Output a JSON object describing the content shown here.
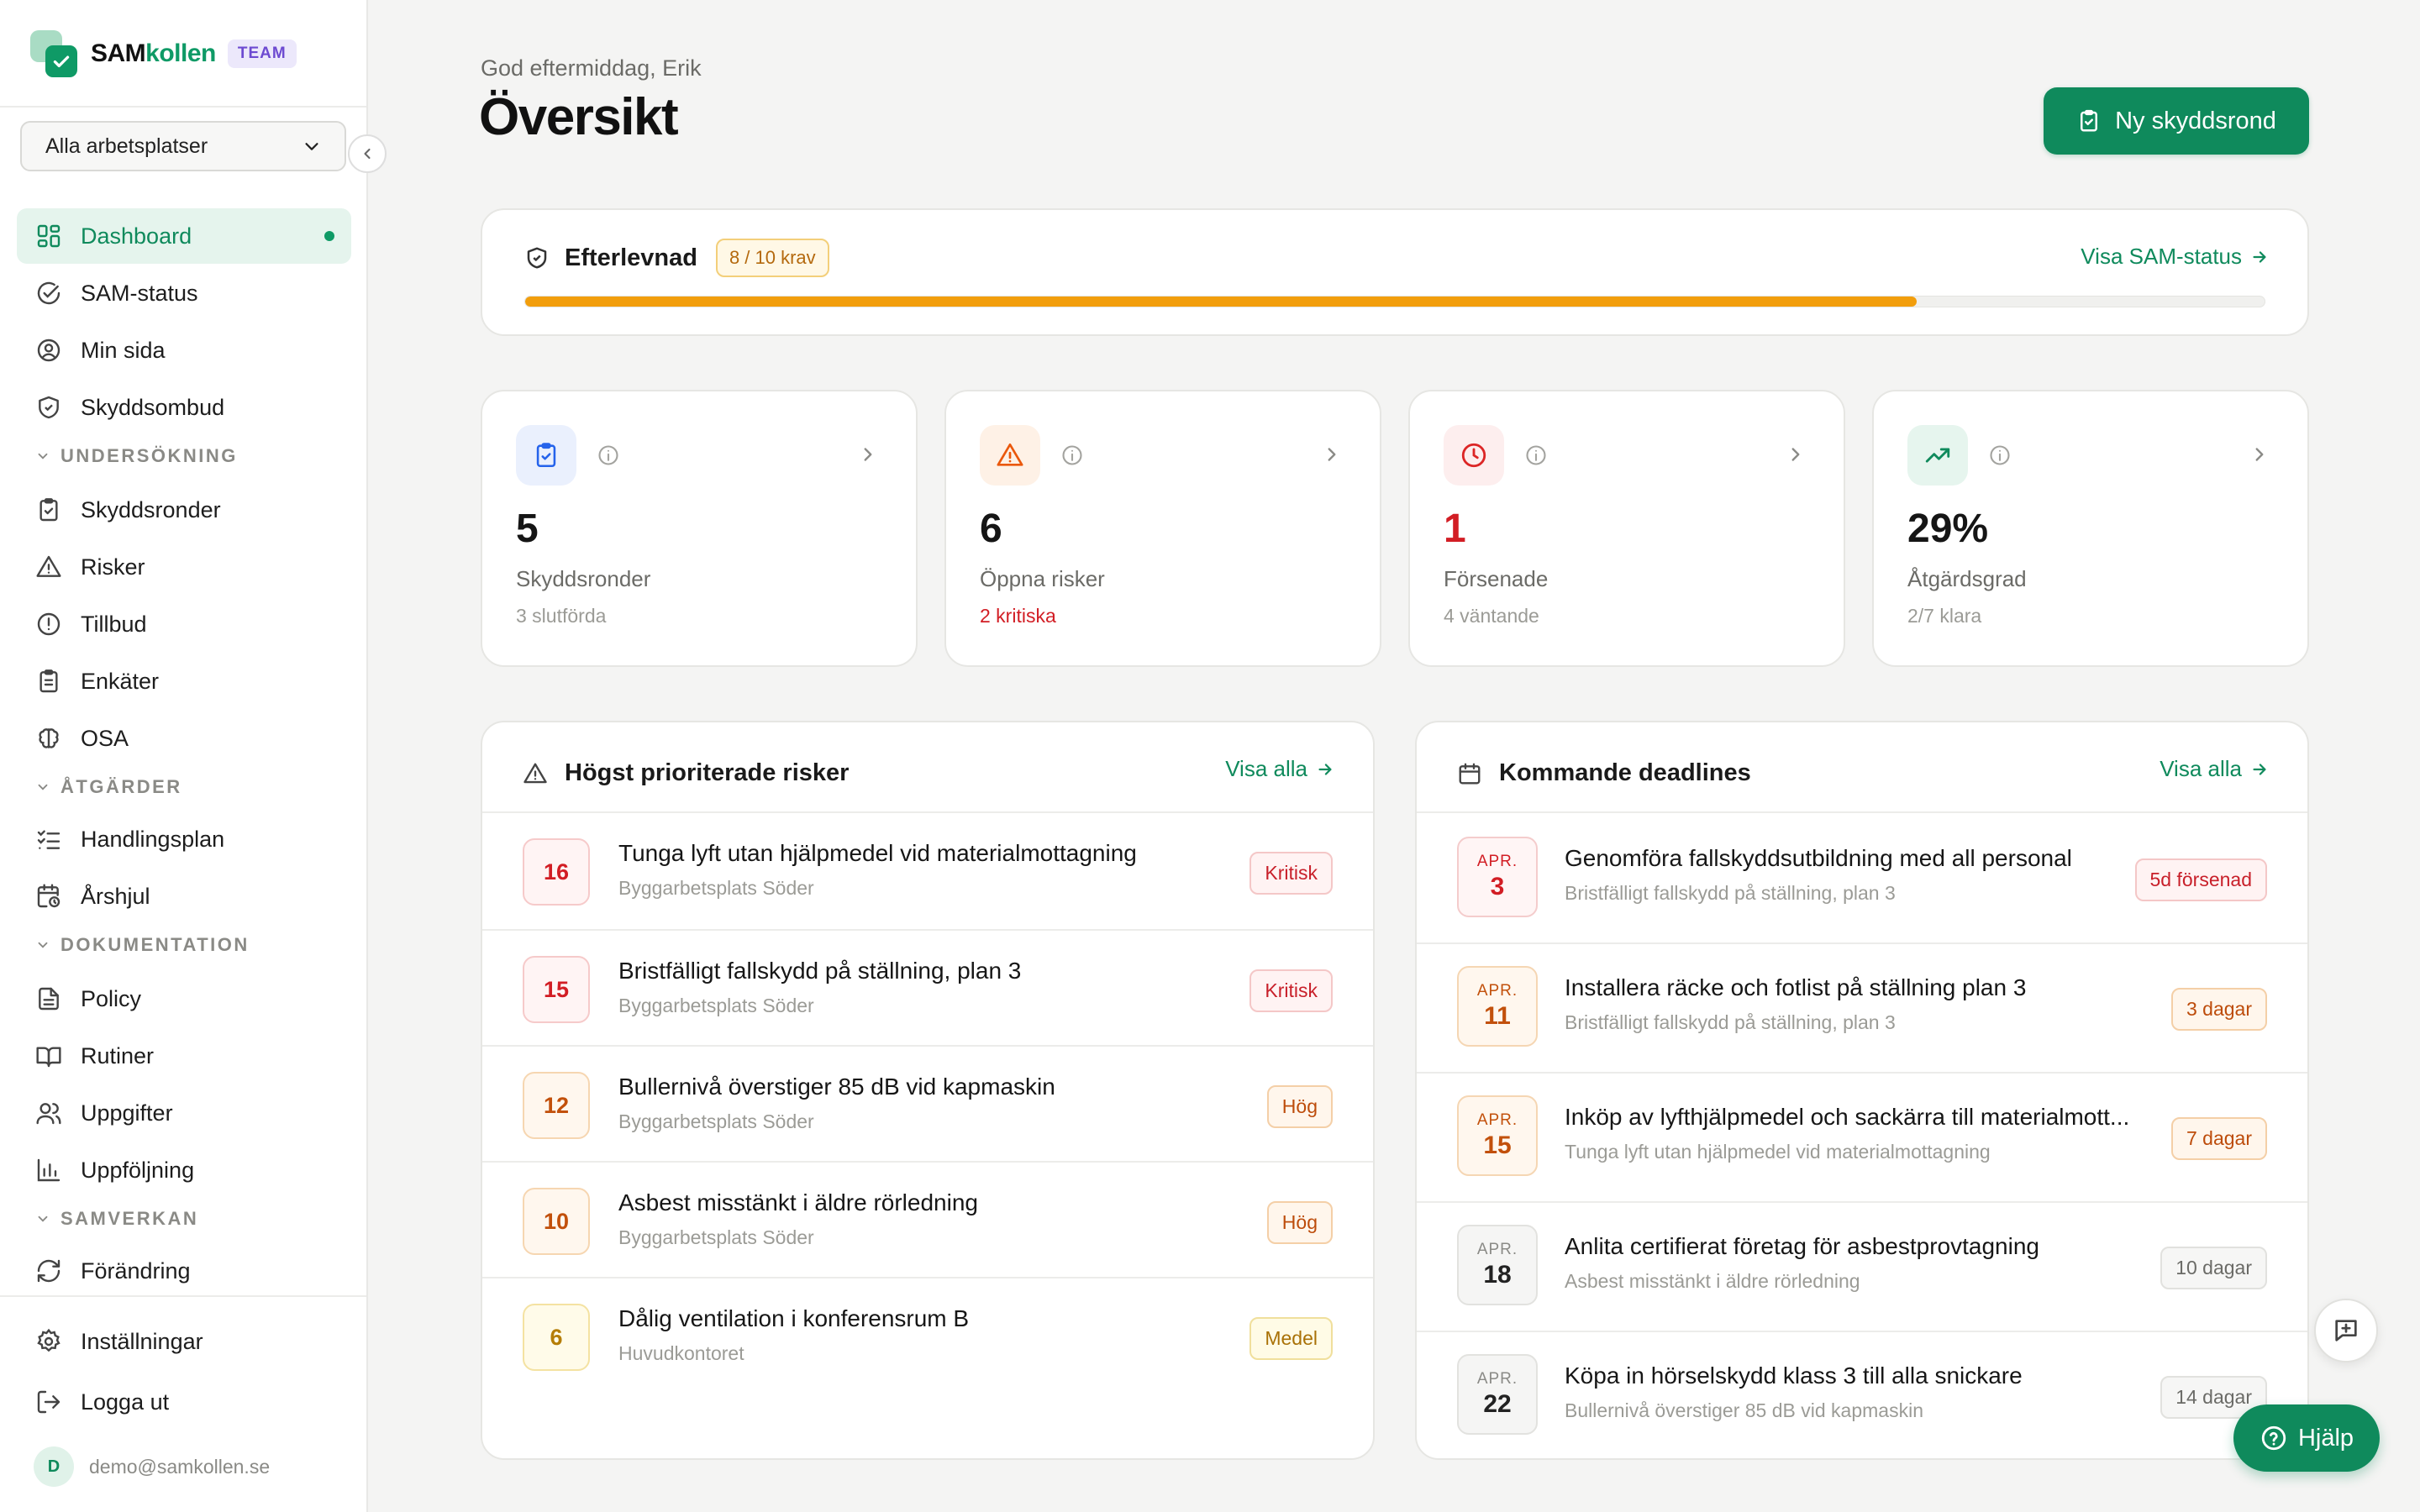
{
  "brand": {
    "name_part1": "SAM",
    "name_part2": "kollen",
    "badge": "TEAM"
  },
  "workspace_select": {
    "value": "Alla arbetsplatser"
  },
  "nav": {
    "dashboard": "Dashboard",
    "sam_status": "SAM-status",
    "min_sida": "Min sida",
    "skyddsombud": "Skyddsombud",
    "section_undersokning": "UNDERSÖKNING",
    "skyddsronder": "Skyddsronder",
    "risker": "Risker",
    "tillbud": "Tillbud",
    "enkater": "Enkäter",
    "osa": "OSA",
    "section_atgarder": "ÅTGÄRDER",
    "handlingsplan": "Handlingsplan",
    "arshjul": "Årshjul",
    "section_dokumentation": "DOKUMENTATION",
    "policy": "Policy",
    "rutiner": "Rutiner",
    "uppgifter": "Uppgifter",
    "uppfoljning": "Uppföljning",
    "section_samverkan": "SAMVERKAN",
    "forandring": "Förändring",
    "installningar": "Inställningar",
    "logga_ut": "Logga ut"
  },
  "user": {
    "initial": "D",
    "email": "demo@samkollen.se"
  },
  "header": {
    "greeting": "God eftermiddag, Erik",
    "title": "Översikt",
    "primary_button": "Ny skyddsrond"
  },
  "compliance": {
    "title": "Efterlevnad",
    "badge": "8 / 10 krav",
    "link": "Visa SAM-status",
    "progress": 0.8
  },
  "stats": [
    {
      "value": "5",
      "label": "Skyddsronder",
      "sub": "3 slutförda"
    },
    {
      "value": "6",
      "label": "Öppna risker",
      "sub": "2 kritiska"
    },
    {
      "value": "1",
      "label": "Försenade",
      "sub": "4 väntande"
    },
    {
      "value": "29%",
      "label": "Åtgärdsgrad",
      "sub": "2/7 klara"
    }
  ],
  "risks": {
    "title": "Högst prioriterade risker",
    "link": "Visa alla",
    "items": [
      {
        "score": "16",
        "title": "Tunga lyft utan hjälpmedel vid materialmottagning",
        "location": "Byggarbetsplats Söder",
        "level": "Kritisk"
      },
      {
        "score": "15",
        "title": "Bristfälligt fallskydd på ställning, plan 3",
        "location": "Byggarbetsplats Söder",
        "level": "Kritisk"
      },
      {
        "score": "12",
        "title": "Bullernivå överstiger 85 dB vid kapmaskin",
        "location": "Byggarbetsplats Söder",
        "level": "Hög"
      },
      {
        "score": "10",
        "title": "Asbest misstänkt i äldre rörledning",
        "location": "Byggarbetsplats Söder",
        "level": "Hög"
      },
      {
        "score": "6",
        "title": "Dålig ventilation i konferensrum B",
        "location": "Huvudkontoret",
        "level": "Medel"
      }
    ]
  },
  "deadlines": {
    "title": "Kommande deadlines",
    "link": "Visa alla",
    "items": [
      {
        "month": "APR.",
        "day": "3",
        "title": "Genomföra fallskyddsutbildning med all personal",
        "sub": "Bristfälligt fallskydd på ställning, plan 3",
        "status": "5d försenad"
      },
      {
        "month": "APR.",
        "day": "11",
        "title": "Installera räcke och fotlist på ställning plan 3",
        "sub": "Bristfälligt fallskydd på ställning, plan 3",
        "status": "3 dagar"
      },
      {
        "month": "APR.",
        "day": "15",
        "title": "Inköp av lyfthjälpmedel och sackärra till materialmott...",
        "sub": "Tunga lyft utan hjälpmedel vid materialmottagning",
        "status": "7 dagar"
      },
      {
        "month": "APR.",
        "day": "18",
        "title": "Anlita certifierat företag för asbestprovtagning",
        "sub": "Asbest misstänkt i äldre rörledning",
        "status": "10 dagar"
      },
      {
        "month": "APR.",
        "day": "22",
        "title": "Köpa in hörselskydd klass 3 till alla snickare",
        "sub": "Bullernivå överstiger 85 dB vid kapmaskin",
        "status": "14 dagar"
      }
    ]
  },
  "help_button": "Hjälp",
  "colors": {
    "brand_green": "#0f8a5c",
    "progress_orange": "#f29e0c",
    "critical_red": "#d21d24"
  }
}
